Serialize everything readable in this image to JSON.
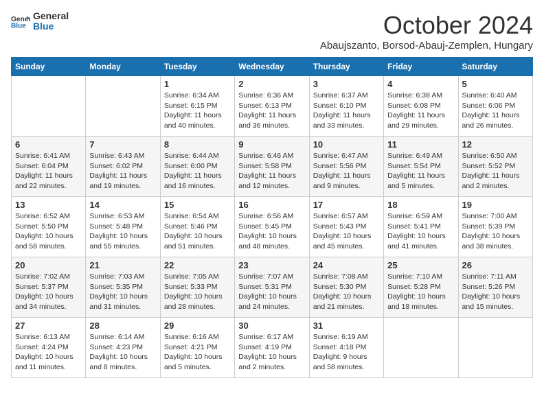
{
  "header": {
    "logo_general": "General",
    "logo_blue": "Blue",
    "month": "October 2024",
    "location": "Abaujszanto, Borsod-Abauj-Zemplen, Hungary"
  },
  "days_of_week": [
    "Sunday",
    "Monday",
    "Tuesday",
    "Wednesday",
    "Thursday",
    "Friday",
    "Saturday"
  ],
  "weeks": [
    [
      {
        "day": "",
        "info": ""
      },
      {
        "day": "",
        "info": ""
      },
      {
        "day": "1",
        "info": "Sunrise: 6:34 AM\nSunset: 6:15 PM\nDaylight: 11 hours and 40 minutes."
      },
      {
        "day": "2",
        "info": "Sunrise: 6:36 AM\nSunset: 6:13 PM\nDaylight: 11 hours and 36 minutes."
      },
      {
        "day": "3",
        "info": "Sunrise: 6:37 AM\nSunset: 6:10 PM\nDaylight: 11 hours and 33 minutes."
      },
      {
        "day": "4",
        "info": "Sunrise: 6:38 AM\nSunset: 6:08 PM\nDaylight: 11 hours and 29 minutes."
      },
      {
        "day": "5",
        "info": "Sunrise: 6:40 AM\nSunset: 6:06 PM\nDaylight: 11 hours and 26 minutes."
      }
    ],
    [
      {
        "day": "6",
        "info": "Sunrise: 6:41 AM\nSunset: 6:04 PM\nDaylight: 11 hours and 22 minutes."
      },
      {
        "day": "7",
        "info": "Sunrise: 6:43 AM\nSunset: 6:02 PM\nDaylight: 11 hours and 19 minutes."
      },
      {
        "day": "8",
        "info": "Sunrise: 6:44 AM\nSunset: 6:00 PM\nDaylight: 11 hours and 16 minutes."
      },
      {
        "day": "9",
        "info": "Sunrise: 6:46 AM\nSunset: 5:58 PM\nDaylight: 11 hours and 12 minutes."
      },
      {
        "day": "10",
        "info": "Sunrise: 6:47 AM\nSunset: 5:56 PM\nDaylight: 11 hours and 9 minutes."
      },
      {
        "day": "11",
        "info": "Sunrise: 6:49 AM\nSunset: 5:54 PM\nDaylight: 11 hours and 5 minutes."
      },
      {
        "day": "12",
        "info": "Sunrise: 6:50 AM\nSunset: 5:52 PM\nDaylight: 11 hours and 2 minutes."
      }
    ],
    [
      {
        "day": "13",
        "info": "Sunrise: 6:52 AM\nSunset: 5:50 PM\nDaylight: 10 hours and 58 minutes."
      },
      {
        "day": "14",
        "info": "Sunrise: 6:53 AM\nSunset: 5:48 PM\nDaylight: 10 hours and 55 minutes."
      },
      {
        "day": "15",
        "info": "Sunrise: 6:54 AM\nSunset: 5:46 PM\nDaylight: 10 hours and 51 minutes."
      },
      {
        "day": "16",
        "info": "Sunrise: 6:56 AM\nSunset: 5:45 PM\nDaylight: 10 hours and 48 minutes."
      },
      {
        "day": "17",
        "info": "Sunrise: 6:57 AM\nSunset: 5:43 PM\nDaylight: 10 hours and 45 minutes."
      },
      {
        "day": "18",
        "info": "Sunrise: 6:59 AM\nSunset: 5:41 PM\nDaylight: 10 hours and 41 minutes."
      },
      {
        "day": "19",
        "info": "Sunrise: 7:00 AM\nSunset: 5:39 PM\nDaylight: 10 hours and 38 minutes."
      }
    ],
    [
      {
        "day": "20",
        "info": "Sunrise: 7:02 AM\nSunset: 5:37 PM\nDaylight: 10 hours and 34 minutes."
      },
      {
        "day": "21",
        "info": "Sunrise: 7:03 AM\nSunset: 5:35 PM\nDaylight: 10 hours and 31 minutes."
      },
      {
        "day": "22",
        "info": "Sunrise: 7:05 AM\nSunset: 5:33 PM\nDaylight: 10 hours and 28 minutes."
      },
      {
        "day": "23",
        "info": "Sunrise: 7:07 AM\nSunset: 5:31 PM\nDaylight: 10 hours and 24 minutes."
      },
      {
        "day": "24",
        "info": "Sunrise: 7:08 AM\nSunset: 5:30 PM\nDaylight: 10 hours and 21 minutes."
      },
      {
        "day": "25",
        "info": "Sunrise: 7:10 AM\nSunset: 5:28 PM\nDaylight: 10 hours and 18 minutes."
      },
      {
        "day": "26",
        "info": "Sunrise: 7:11 AM\nSunset: 5:26 PM\nDaylight: 10 hours and 15 minutes."
      }
    ],
    [
      {
        "day": "27",
        "info": "Sunrise: 6:13 AM\nSunset: 4:24 PM\nDaylight: 10 hours and 11 minutes."
      },
      {
        "day": "28",
        "info": "Sunrise: 6:14 AM\nSunset: 4:23 PM\nDaylight: 10 hours and 8 minutes."
      },
      {
        "day": "29",
        "info": "Sunrise: 6:16 AM\nSunset: 4:21 PM\nDaylight: 10 hours and 5 minutes."
      },
      {
        "day": "30",
        "info": "Sunrise: 6:17 AM\nSunset: 4:19 PM\nDaylight: 10 hours and 2 minutes."
      },
      {
        "day": "31",
        "info": "Sunrise: 6:19 AM\nSunset: 4:18 PM\nDaylight: 9 hours and 58 minutes."
      },
      {
        "day": "",
        "info": ""
      },
      {
        "day": "",
        "info": ""
      }
    ]
  ]
}
